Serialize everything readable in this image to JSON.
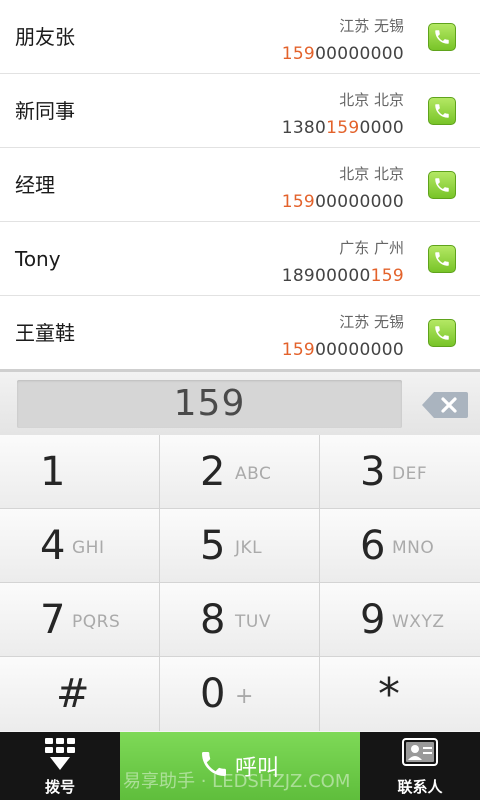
{
  "contacts": [
    {
      "name": "朋友张",
      "location": "江苏 无锡",
      "number_pre": "",
      "number_hl": "159",
      "number_post": "00000000"
    },
    {
      "name": "新同事",
      "location": "北京 北京",
      "number_pre": "1380",
      "number_hl": "159",
      "number_post": "0000"
    },
    {
      "name": "经理",
      "location": "北京 北京",
      "number_pre": "",
      "number_hl": "159",
      "number_post": "00000000"
    },
    {
      "name": "Tony",
      "location": "广东 广州",
      "number_pre": "18900000",
      "number_hl": "159",
      "number_post": ""
    },
    {
      "name": "王童鞋",
      "location": "江苏 无锡",
      "number_pre": "",
      "number_hl": "159",
      "number_post": "00000000"
    }
  ],
  "dialer": {
    "input": "159"
  },
  "keys": [
    {
      "digit": "1",
      "letters": ""
    },
    {
      "digit": "2",
      "letters": "ABC"
    },
    {
      "digit": "3",
      "letters": "DEF"
    },
    {
      "digit": "4",
      "letters": "GHI"
    },
    {
      "digit": "5",
      "letters": "JKL"
    },
    {
      "digit": "6",
      "letters": "MNO"
    },
    {
      "digit": "7",
      "letters": "PQRS"
    },
    {
      "digit": "8",
      "letters": "TUV"
    },
    {
      "digit": "9",
      "letters": "WXYZ"
    },
    {
      "digit": "#",
      "letters": ""
    },
    {
      "digit": "0",
      "letters": "+"
    },
    {
      "digit": "*",
      "letters": ""
    }
  ],
  "bottom_bar": {
    "dial_label": "拨号",
    "call_label": "呼叫",
    "contacts_label": "联系人"
  },
  "watermark": "易享助手 · LEDSHZJZ.COM",
  "colors": {
    "highlight": "#e3622b",
    "call_green": "#6fcb48",
    "bottom_bar": "#151515"
  },
  "icons": {
    "row_call": "phone-icon",
    "backspace": "backspace-icon",
    "dial_tab": "keypad-icon",
    "call": "phone-icon",
    "contacts_tab": "contact-card-icon"
  }
}
